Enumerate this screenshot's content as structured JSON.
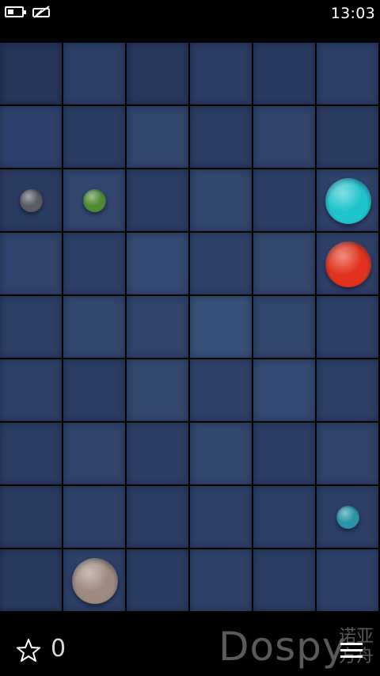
{
  "status_bar": {
    "time": "13:03",
    "battery_icon": "battery-low-icon",
    "signal_icon": "no-signal-icon"
  },
  "board": {
    "columns": 6,
    "rows": 9,
    "tile_colors": [
      [
        "#26365a",
        "#2c3f68",
        "#27375c",
        "#2b3d66",
        "#293a62",
        "#2c3f69"
      ],
      [
        "#2e426d",
        "#2a3c63",
        "#31466f",
        "#2b3d64",
        "#30446e",
        "#2b3c62"
      ],
      [
        "#2a3b62",
        "#31456f",
        "#2b3d65",
        "#32476f",
        "#2c3e66",
        "#2f426b"
      ],
      [
        "#30446d",
        "#2d3f68",
        "#344973",
        "#2f426b",
        "#33486f",
        "#2e406a"
      ],
      [
        "#2d3f67",
        "#32476f",
        "#30446d",
        "#37517a",
        "#31466e",
        "#2d4069"
      ],
      [
        "#2e416a",
        "#2b3d65",
        "#33486f",
        "#2f426b",
        "#344973",
        "#2d3f67"
      ],
      [
        "#2b3d64",
        "#30446e",
        "#2c3e66",
        "#32476f",
        "#2b3d66",
        "#30436c"
      ],
      [
        "#2a3b62",
        "#2f426b",
        "#2b3d65",
        "#2e416a",
        "#2c3f68",
        "#2d3f67"
      ],
      [
        "#293a61",
        "#2d4069",
        "#2a3c63",
        "#2f426b",
        "#2b3d64",
        "#2e406a"
      ]
    ],
    "balls": [
      {
        "row": 2,
        "col": 0,
        "size": "small",
        "color": "#5a5c64",
        "name": "gray"
      },
      {
        "row": 2,
        "col": 1,
        "size": "small",
        "color": "#4f8a34",
        "name": "green"
      },
      {
        "row": 2,
        "col": 5,
        "size": "large",
        "color": "#1fc4cc",
        "name": "cyan"
      },
      {
        "row": 3,
        "col": 5,
        "size": "large",
        "color": "#e0321c",
        "name": "red"
      },
      {
        "row": 7,
        "col": 5,
        "size": "small",
        "color": "#2a94a8",
        "name": "teal"
      },
      {
        "row": 8,
        "col": 1,
        "size": "large",
        "color": "#9e8a7e",
        "name": "tan"
      }
    ]
  },
  "footer": {
    "star_icon": "star-outline-icon",
    "score": "0",
    "watermark": "Dospy",
    "watermark_cn": "诺亚方舟",
    "menu_icon": "hamburger-menu-icon"
  }
}
